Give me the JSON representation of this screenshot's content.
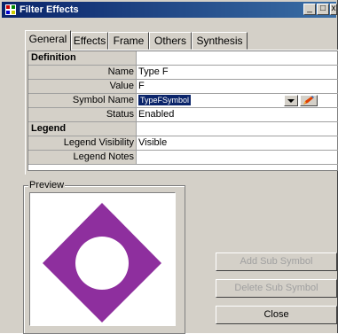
{
  "window": {
    "title": "Filter Effects",
    "controls": {
      "minimize": "_",
      "maximize": "□",
      "close": "x"
    }
  },
  "tabs": [
    {
      "label": "General",
      "active": true
    },
    {
      "label": "Effects"
    },
    {
      "label": "Frame"
    },
    {
      "label": "Others"
    },
    {
      "label": "Synthesis"
    }
  ],
  "grid": {
    "definition_header": "Definition",
    "rows": [
      {
        "name": "Name",
        "value": "Type F"
      },
      {
        "name": "Value",
        "value": "F"
      },
      {
        "name": "Symbol Name",
        "value": "TypeFSymbol"
      },
      {
        "name": "Status",
        "value": "Enabled"
      }
    ],
    "legend_header": "Legend",
    "legend_rows": [
      {
        "name": "Legend Visibility",
        "value": "Visible"
      },
      {
        "name": "Legend Notes",
        "value": ""
      }
    ]
  },
  "preview": {
    "label": "Preview",
    "symbol_color": "#8e2f9e",
    "symbol_shape": "diamond-with-circular-hole"
  },
  "buttons": {
    "add_sub_symbol": "Add Sub Symbol",
    "delete_sub_symbol": "Delete Sub Symbol",
    "close": "Close"
  },
  "colors": {
    "title_bar": "#0a246a",
    "selection": "#0a246a",
    "face": "#d4d0c8"
  }
}
